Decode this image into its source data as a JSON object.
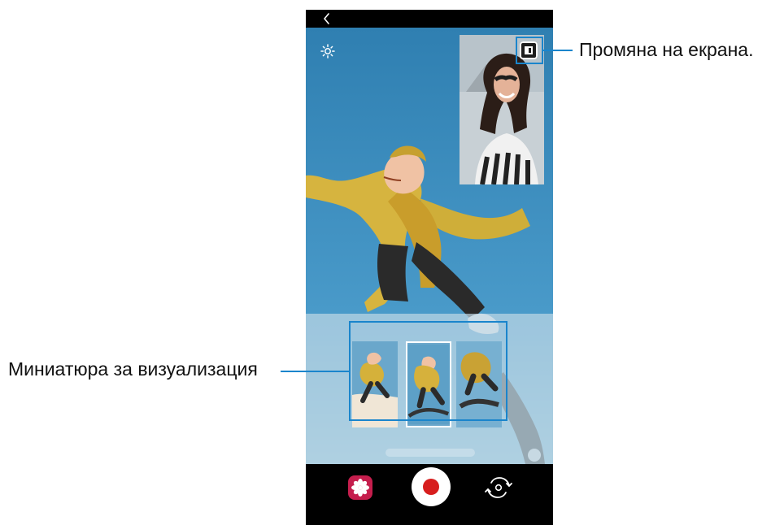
{
  "annotations": {
    "top_right": "Промяна на екрана.",
    "left": "Миниатюра за визуализация"
  },
  "controls": {
    "back": "back-icon",
    "settings": "settings-icon",
    "switch": "screen-switch-icon",
    "effect": "flower-effect-icon",
    "record": "record-icon",
    "flip": "camera-flip-icon"
  },
  "colors": {
    "accent": "#1a85cc",
    "record": "#d71d1d",
    "effect": "#c51e4d"
  }
}
